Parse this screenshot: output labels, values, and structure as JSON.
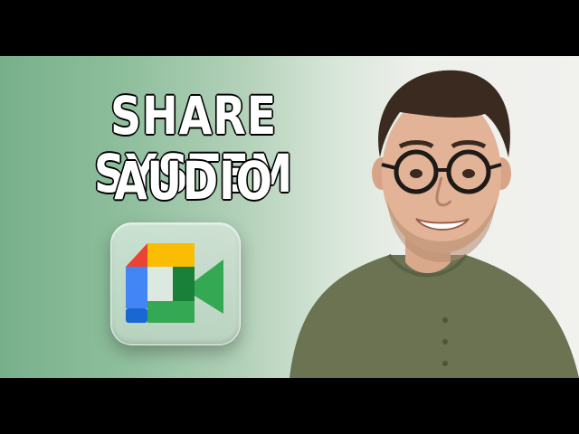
{
  "headline": {
    "line1": "SHARE SYSTEM",
    "line2": "AUDIO"
  },
  "logo": {
    "name": "google-meet-icon",
    "colors": {
      "red": "#ea4335",
      "yellow": "#fbbc04",
      "blue": "#4285f4",
      "green": "#34a853",
      "dark_green": "#188038"
    }
  },
  "background": {
    "left": "#78b08c",
    "right": "#f1f1ee"
  },
  "person": {
    "shirt_color": "#6b7352",
    "hair_color": "#3b2a20"
  }
}
